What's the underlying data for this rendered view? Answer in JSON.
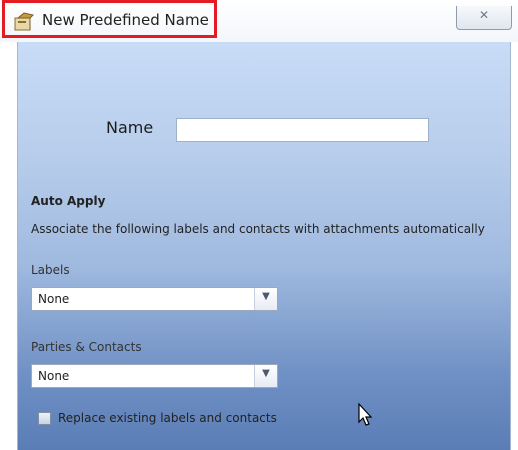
{
  "window": {
    "title": "New Predefined Name",
    "close_glyph": "✕",
    "title_icon": "name-tag-icon"
  },
  "form": {
    "name_label": "Name",
    "name_value": "",
    "auto_apply_heading": "Auto Apply",
    "auto_apply_description": "Associate the following labels and contacts with attachments automatically",
    "labels_caption": "Labels",
    "labels_selected": "None",
    "parties_caption": "Parties & Contacts",
    "parties_selected": "None",
    "dropdown_glyph": "▼",
    "replace_checkbox_label": "Replace existing labels and contacts",
    "replace_checked": false
  },
  "colors": {
    "highlight": "#e51b24",
    "panel_top": "#c8dcf7",
    "panel_bottom": "#5a7db6"
  }
}
